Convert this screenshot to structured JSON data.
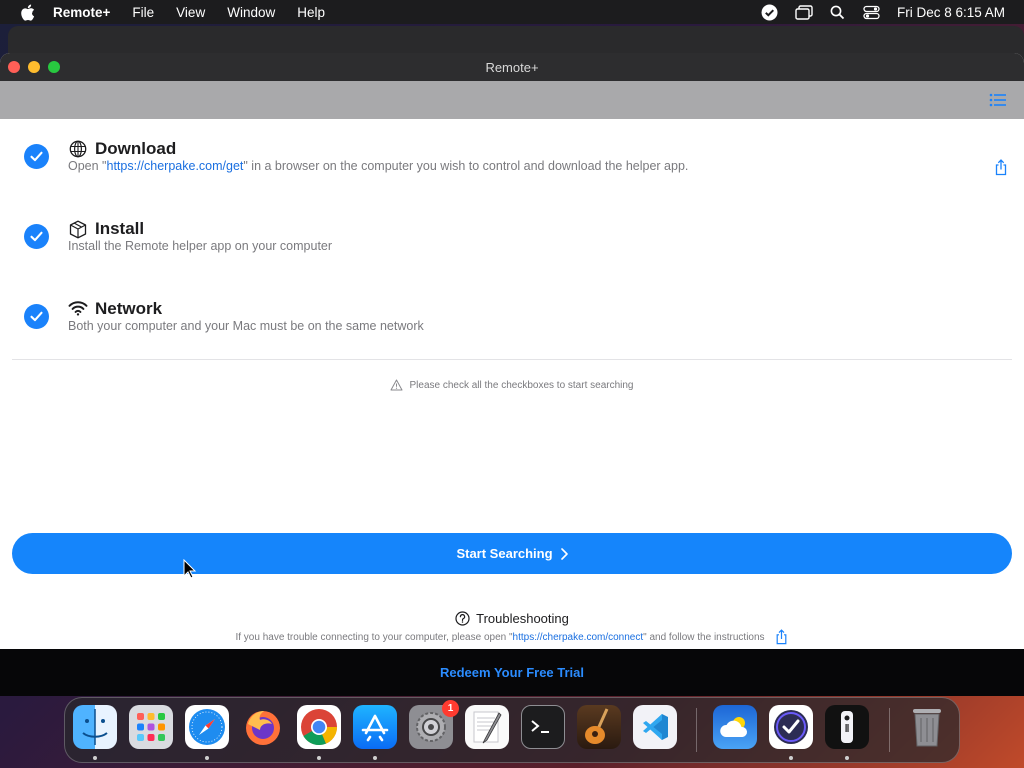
{
  "menubar": {
    "app_name": "Remote+",
    "items": [
      "File",
      "View",
      "Window",
      "Help"
    ],
    "clock": "Fri Dec 8  6:15 AM"
  },
  "window": {
    "title": "Remote+"
  },
  "steps": [
    {
      "title": "Download",
      "desc_prefix": "Open \"",
      "desc_link": "https://cherpake.com/get",
      "desc_suffix": "\" in a browser on the computer you wish to control and download the helper app.",
      "icon": "globe-icon",
      "checked": true
    },
    {
      "title": "Install",
      "desc": "Install the Remote helper app on your computer",
      "icon": "box-icon",
      "checked": true
    },
    {
      "title": "Network",
      "desc": "Both your computer and your Mac must be on the same network",
      "icon": "wifi-icon",
      "checked": true
    }
  ],
  "hint": "Please check all the checkboxes to start searching",
  "start_button": "Start Searching",
  "troubleshooting": {
    "title": "Troubleshooting",
    "desc_prefix": "If you have trouble connecting to your computer, please open \"",
    "desc_link": "https://cherpake.com/connect",
    "desc_suffix": "\" and follow the instructions"
  },
  "footer": {
    "redeem": "Redeem Your Free Trial"
  },
  "dock": {
    "apps": [
      "finder-icon",
      "launchpad-icon",
      "safari-icon",
      "firefox-icon",
      "chrome-icon",
      "app-store-icon",
      "system-settings-icon",
      "textedit-icon",
      "terminal-icon",
      "garageband-icon",
      "vscode-icon",
      "weather-icon",
      "omnifocus-icon",
      "remote-icon",
      "trash-icon"
    ],
    "settings_badge": "1"
  },
  "colors": {
    "accent": "#1585fb",
    "check": "#1a82fb",
    "link": "#1a6fe0"
  }
}
